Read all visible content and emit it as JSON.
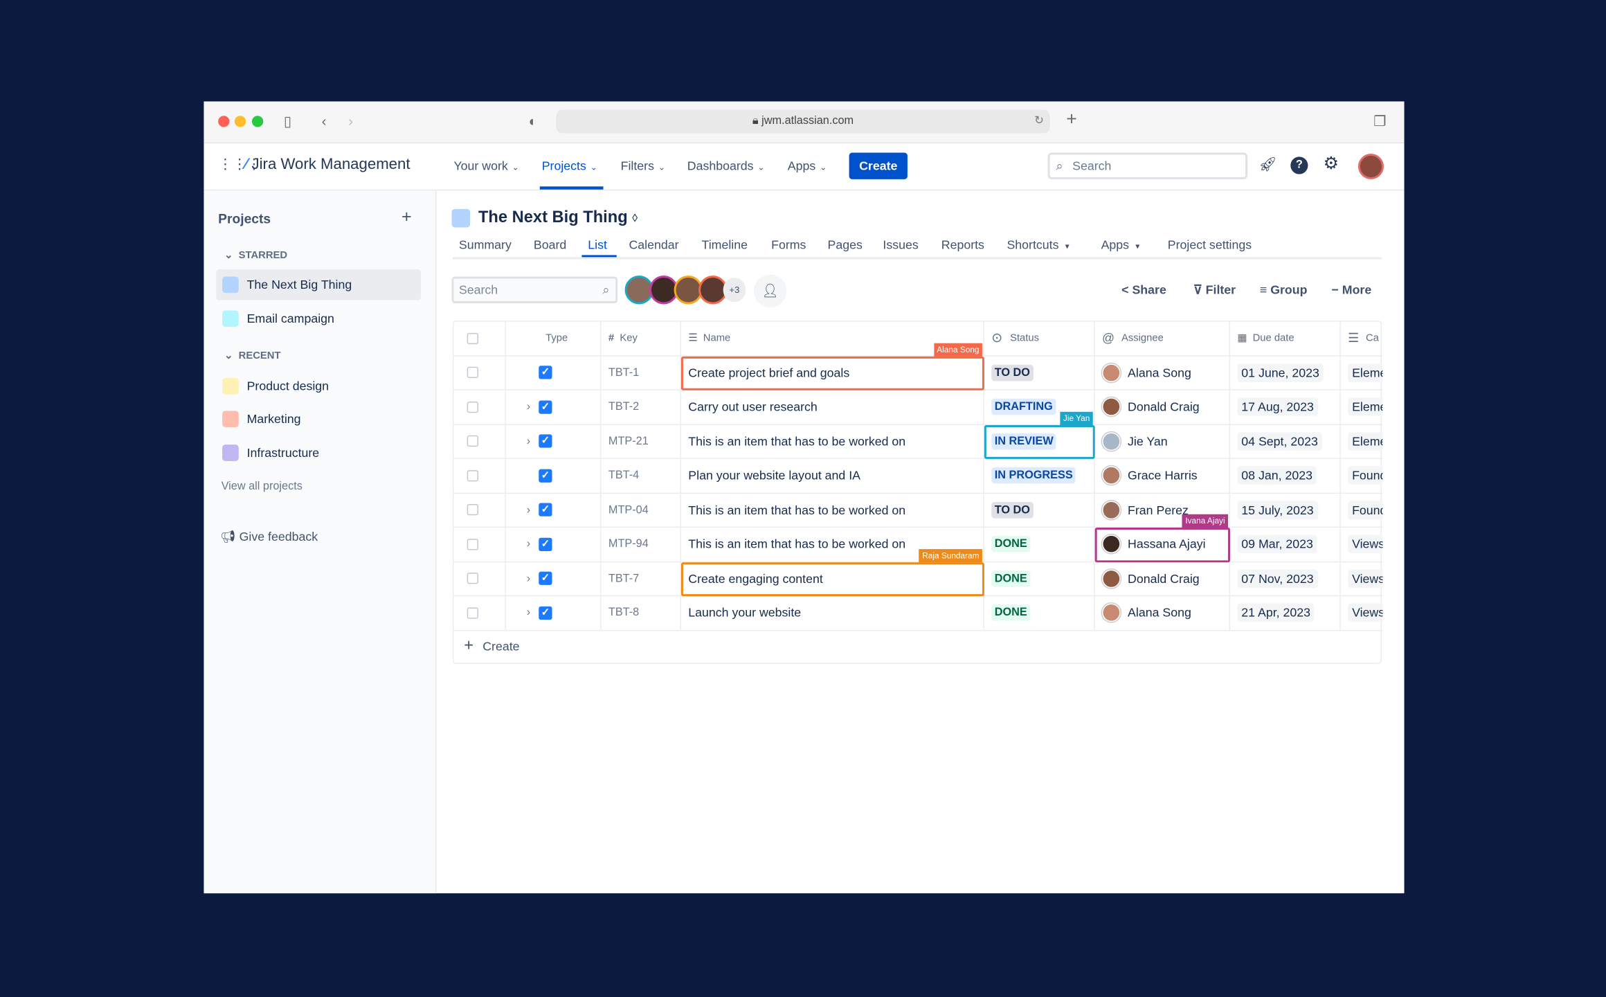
{
  "browser": {
    "url": "jwm.atlassian.com"
  },
  "nav": {
    "brand": "Jira Work Management",
    "items": [
      "Your work",
      "Projects",
      "Filters",
      "Dashboards",
      "Apps"
    ],
    "create": "Create",
    "search_placeholder": "Search"
  },
  "sidebar": {
    "title": "Projects",
    "starred_label": "STARRED",
    "starred": [
      "The Next Big Thing",
      "Email campaign"
    ],
    "recent_label": "RECENT",
    "recent": [
      "Product design",
      "Marketing",
      "Infrastructure"
    ],
    "view_all": "View all projects",
    "feedback": "Give feedback"
  },
  "project": {
    "title": "The Next Big Thing",
    "tabs": [
      "Summary",
      "Board",
      "List",
      "Calendar",
      "Timeline",
      "Forms",
      "Pages",
      "Issues",
      "Reports",
      "Shortcuts",
      "Apps",
      "Project settings"
    ],
    "active_tab": "List"
  },
  "toolbar": {
    "search_placeholder": "Search",
    "extra_members": "+3",
    "share": "Share",
    "filter": "Filter",
    "group": "Group",
    "more": "More"
  },
  "table": {
    "headers": {
      "type": "Type",
      "key": "Key",
      "name": "Name",
      "status": "Status",
      "assignee": "Assignee",
      "due": "Due date",
      "category": "Ca"
    },
    "rows": [
      {
        "key": "TBT-1",
        "name": "Create project brief and goals",
        "status": "TO DO",
        "assignee": "Alana Song",
        "due": "01 June, 2023",
        "category": "Eleme",
        "expand": false
      },
      {
        "key": "TBT-2",
        "name": "Carry out user research",
        "status": "DRAFTING",
        "assignee": "Donald Craig",
        "due": "17 Aug, 2023",
        "category": "Eleme",
        "expand": true
      },
      {
        "key": "MTP-21",
        "name": "This is an item that has to be worked on",
        "status": "IN REVIEW",
        "assignee": "Jie Yan",
        "due": "04 Sept, 2023",
        "category": "Eleme",
        "expand": true
      },
      {
        "key": "TBT-4",
        "name": "Plan your website layout and IA",
        "status": "IN PROGRESS",
        "assignee": "Grace Harris",
        "due": "08 Jan, 2023",
        "category": "Found",
        "expand": false
      },
      {
        "key": "MTP-04",
        "name": "This is an item that has to be worked on",
        "status": "TO DO",
        "assignee": "Fran Perez",
        "due": "15 July, 2023",
        "category": "Found",
        "expand": true
      },
      {
        "key": "MTP-94",
        "name": "This is an item that has to be worked on",
        "status": "DONE",
        "assignee": "Hassana Ajayi",
        "due": "09 Mar, 2023",
        "category": "Views",
        "expand": true
      },
      {
        "key": "TBT-7",
        "name": "Create engaging content",
        "status": "DONE",
        "assignee": "Donald Craig",
        "due": "07 Nov, 2023",
        "category": "Views",
        "expand": true
      },
      {
        "key": "TBT-8",
        "name": "Launch your website",
        "status": "DONE",
        "assignee": "Alana Song",
        "due": "21 Apr, 2023",
        "category": "Views",
        "expand": true
      }
    ],
    "create": "Create"
  },
  "collaborators": [
    {
      "name": "Alana Song",
      "color": "#f4694a"
    },
    {
      "name": "Jie Yan",
      "color": "#1aa7c9"
    },
    {
      "name": "Ivana Ajayi",
      "color": "#b03a88"
    },
    {
      "name": "Raja Sundaram",
      "color": "#f08a16"
    }
  ],
  "status_colors": {
    "TO DO": [
      "#dfe1e6",
      "#172b4d"
    ],
    "DRAFTING": [
      "#deebff",
      "#0747a6"
    ],
    "IN REVIEW": [
      "#deebff",
      "#0747a6"
    ],
    "IN PROGRESS": [
      "#deebff",
      "#0747a6"
    ],
    "DONE": [
      "#e3fcef",
      "#006644"
    ]
  }
}
